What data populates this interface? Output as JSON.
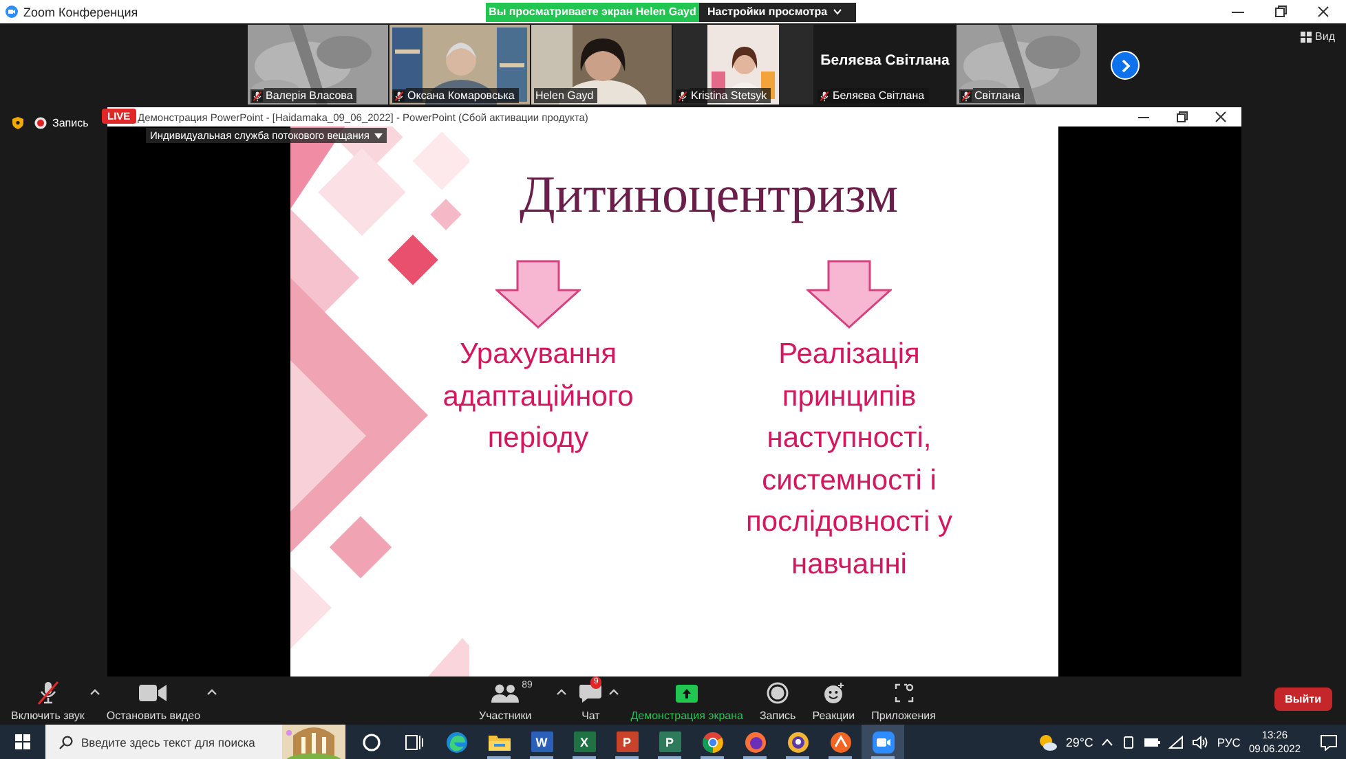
{
  "window": {
    "title": "Zoom Конференция"
  },
  "share_banner": {
    "text": "Вы просматриваете экран Helen Gayd",
    "settings_menu": "Настройки просмотра"
  },
  "gallery": {
    "view_button": "Вид",
    "tiles": [
      {
        "kind": "picture",
        "name": "Валерія Власова",
        "muted": true,
        "speaking": false
      },
      {
        "kind": "picture",
        "name": "Оксана Комаровська",
        "muted": true,
        "speaking": false
      },
      {
        "kind": "picture",
        "name": "Helen Gayd",
        "muted": false,
        "speaking": true
      },
      {
        "kind": "picture",
        "name": "Kristina Stetsyk",
        "muted": true,
        "speaking": false
      },
      {
        "kind": "name",
        "display_name": "Беляєва Світлана",
        "name": "Беляєва Світлана",
        "muted": true,
        "speaking": false
      },
      {
        "kind": "picture",
        "name": "Світлана",
        "muted": true,
        "speaking": false
      }
    ]
  },
  "recording": {
    "label": "Запись"
  },
  "live_badge": "LIVE",
  "stream_menu": "Индивидуальная служба потокового вещания",
  "shared_window": {
    "title": "Демонстрация PowerPoint - [Haidamaka_09_06_2022] - PowerPoint (Сбой активации продукта)"
  },
  "slide": {
    "title": "Дитиноцентризм",
    "columns": [
      "Урахування адаптаційного періоду",
      "Реалізація принципів наступності, системності і послідовності у навчанні"
    ]
  },
  "toolbar": {
    "leave_button": "Выйти",
    "items": [
      {
        "kind": "mic",
        "label": "Включить звук",
        "muted": true,
        "caret": true
      },
      {
        "kind": "video",
        "label": "Остановить видео",
        "caret": true
      },
      {
        "kind": "participants",
        "label": "Участники",
        "count": "89",
        "caret": true
      },
      {
        "kind": "chat",
        "label": "Чат",
        "badge": "9",
        "caret": true
      },
      {
        "kind": "share",
        "label": "Демонстрация экрана",
        "active": true
      },
      {
        "kind": "record",
        "label": "Запись"
      },
      {
        "kind": "reactions",
        "label": "Реакции"
      },
      {
        "kind": "apps",
        "label": "Приложения"
      }
    ]
  },
  "taskbar": {
    "search_placeholder": "Введите здесь текст для поиска",
    "apps": [
      {
        "kind": "cortana",
        "running": false,
        "selected": false
      },
      {
        "kind": "task-view",
        "running": false,
        "selected": false
      },
      {
        "kind": "edge",
        "running": false,
        "selected": false
      },
      {
        "kind": "explorer",
        "running": true,
        "selected": false
      },
      {
        "kind": "word",
        "letter": "W",
        "running": true,
        "selected": false
      },
      {
        "kind": "excel",
        "letter": "X",
        "running": true,
        "selected": false
      },
      {
        "kind": "powerpoint",
        "letter": "P",
        "running": true,
        "selected": false
      },
      {
        "kind": "project",
        "letter": "P",
        "running": true,
        "selected": false
      },
      {
        "kind": "chrome",
        "running": true,
        "selected": false
      },
      {
        "kind": "firefox",
        "running": true,
        "selected": false
      },
      {
        "kind": "browser",
        "running": true,
        "selected": false
      },
      {
        "kind": "app",
        "running": true,
        "selected": false
      },
      {
        "kind": "zoom",
        "running": true,
        "selected": true
      }
    ],
    "tray": {
      "temperature": "29°C",
      "language": "РУС",
      "time": "13:26",
      "date": "09.06.2022"
    }
  }
}
